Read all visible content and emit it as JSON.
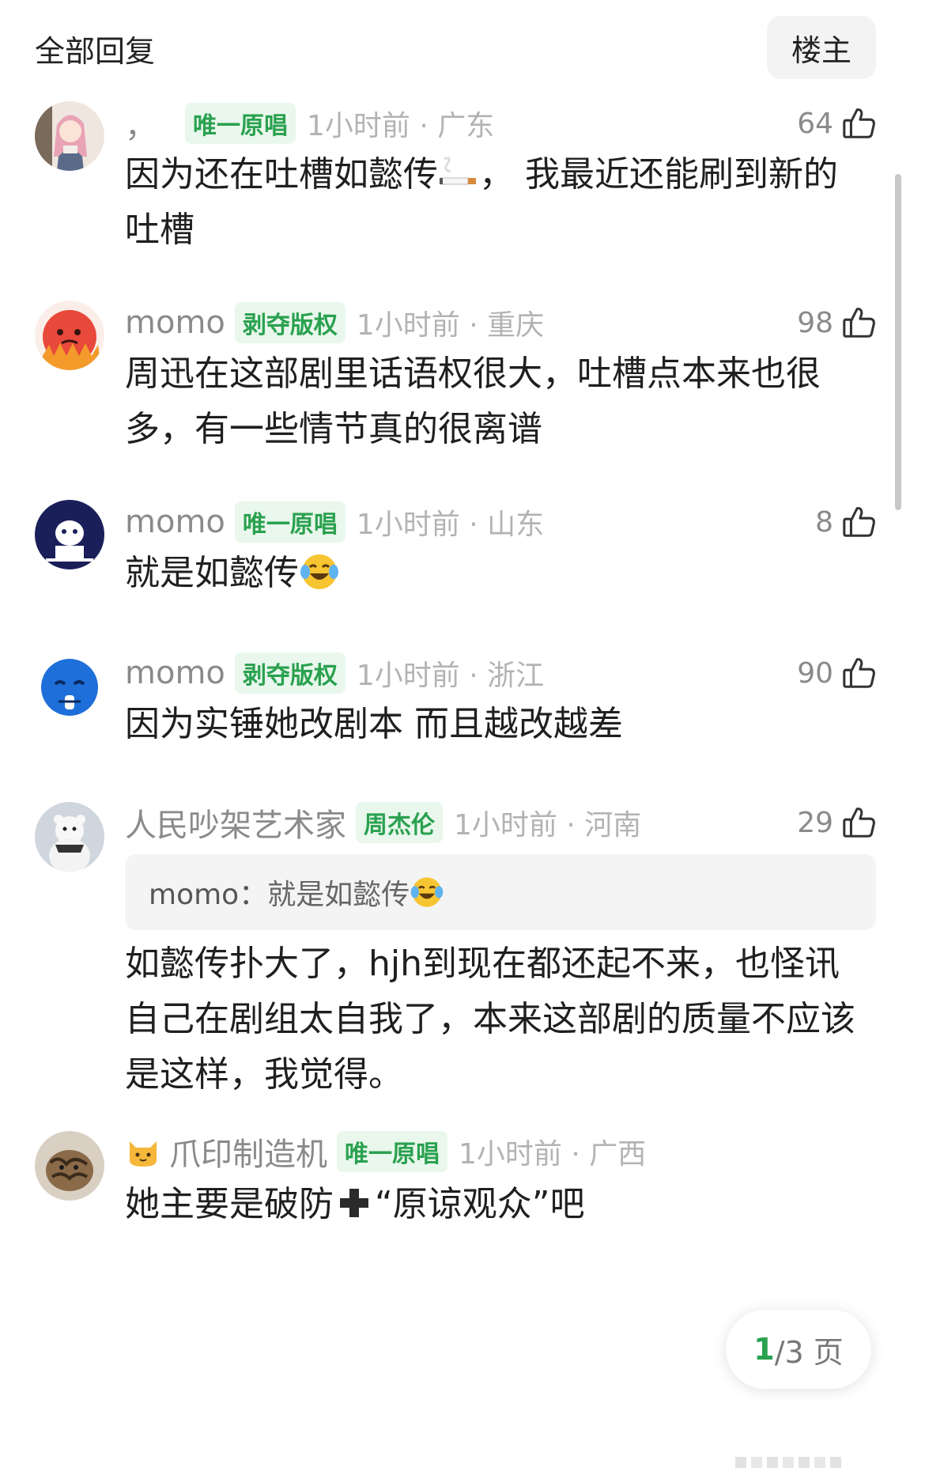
{
  "header": {
    "title": "全部回复",
    "op_button": "楼主"
  },
  "comments": [
    {
      "username": "，",
      "badge": "唯一原唱",
      "time_location": "1小时前 · 广东",
      "likes": "64",
      "text_parts": [
        "因为还在吐槽如懿传",
        "， 我最近还能刷到新的吐槽"
      ],
      "inline_emoji": "cigarette-emoji"
    },
    {
      "username": "momo",
      "badge": "剥夺版权",
      "time_location": "1小时前 · 重庆",
      "likes": "98",
      "text": "周迅在这部剧里话语权很大，吐槽点本来也很多，有一些情节真的很离谱"
    },
    {
      "username": "momo",
      "badge": "唯一原唱",
      "time_location": "1小时前 · 山东",
      "likes": "8",
      "text": "就是如懿传",
      "inline_emoji": "laughing-tears-emoji"
    },
    {
      "username": "momo",
      "badge": "剥夺版权",
      "time_location": "1小时前 · 浙江",
      "likes": "90",
      "text": "因为实锤她改剧本 而且越改越差"
    },
    {
      "username": "人民吵架艺术家",
      "badge": "周杰伦",
      "time_location": "1小时前 · 河南",
      "likes": "29",
      "quote_author": "momo：",
      "quote_text": "就是如懿传",
      "text": "如懿传扑大了，hjh到现在都还起不来，也怪讯自己在剧组太自我了，本来这部剧的质量不应该是这样，我觉得。"
    },
    {
      "username": "爪印制造机",
      "badge": "唯一原唱",
      "time_location": "1小时前 · 广西",
      "text_parts": [
        "她主要是破防",
        "“原谅观众”吧"
      ],
      "user_emoji": "cat-emoji",
      "inline_emoji": "heavy-plus-emoji"
    }
  ],
  "pager": {
    "current": "1",
    "total": "/3 页"
  },
  "colors": {
    "badge_green": "#2aa14f",
    "badge_bg": "#e9f7ec",
    "meta_gray": "#b3b3b3"
  }
}
